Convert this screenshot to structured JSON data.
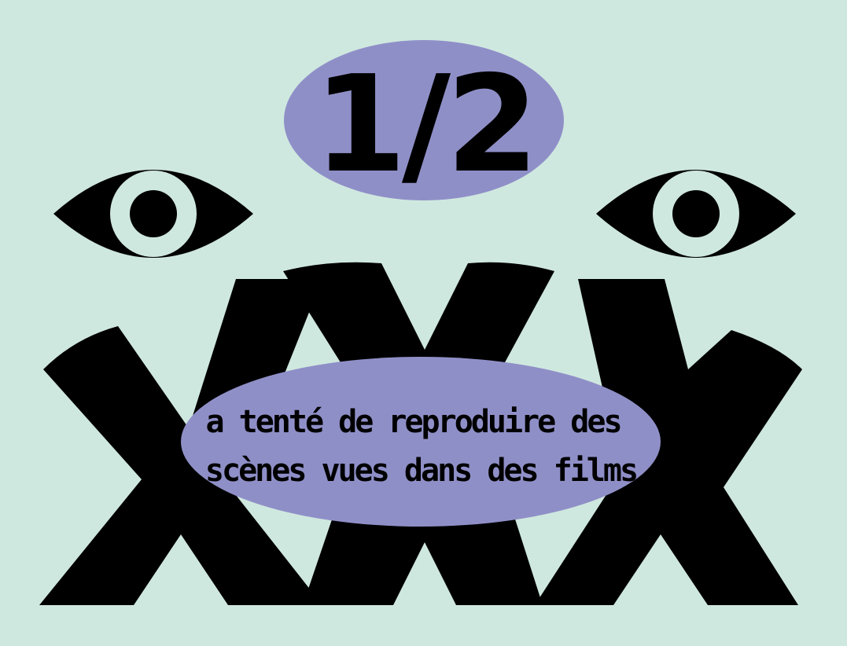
{
  "fraction": "1/2",
  "caption": {
    "line1": "a tenté de reproduire des",
    "line2": "scènes vues dans des films"
  },
  "big_letters": [
    "X",
    "X",
    "X"
  ],
  "icons": [
    "eye-icon",
    "eye-icon"
  ],
  "colors": {
    "background": "#cfe8df",
    "oval": "#8f8fc8",
    "ink": "#000000",
    "iris": "#cfe8df"
  }
}
